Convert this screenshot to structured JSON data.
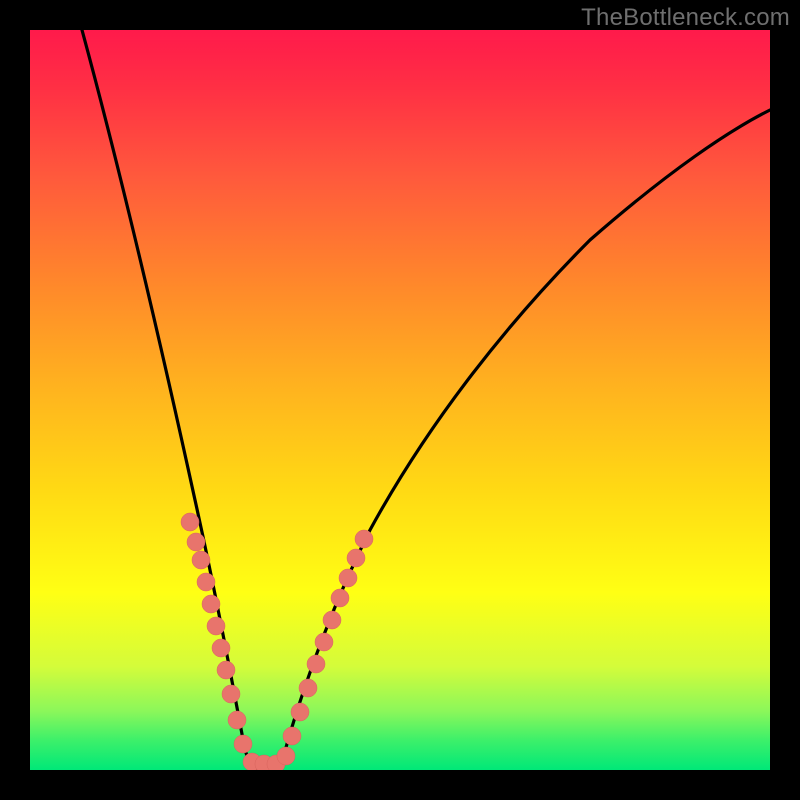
{
  "watermark": "TheBottleneck.com",
  "colors": {
    "frame": "#000000",
    "gradient_top": "#ff1a4b",
    "gradient_mid": "#ffd914",
    "gradient_bottom": "#00e878",
    "curve": "#000000",
    "dots": "#e8746c"
  },
  "chart_data": {
    "type": "line",
    "title": "",
    "xlabel": "",
    "ylabel": "",
    "xlim": [
      0,
      100
    ],
    "ylim": [
      0,
      100
    ],
    "grid": false,
    "legend": false,
    "note": "V-shaped curve; minimum at x≈30, y≈0. Dots cluster along the two arms in the lower ~35% of the chart.",
    "series": [
      {
        "name": "curve",
        "x": [
          7,
          10,
          13,
          16,
          19,
          22,
          25,
          28,
          30,
          32,
          35,
          40,
          45,
          50,
          55,
          60,
          65,
          70,
          75,
          80,
          85,
          90,
          95,
          100
        ],
        "y": [
          100,
          88,
          76,
          64,
          53,
          42,
          31,
          16,
          0,
          10,
          22,
          36,
          46,
          54,
          61,
          67,
          72,
          76,
          80,
          83,
          86,
          89,
          92,
          94
        ]
      },
      {
        "name": "dots-left",
        "x": [
          19,
          20,
          21,
          22,
          23,
          24,
          25,
          26,
          27,
          28,
          29
        ],
        "y": [
          34,
          32,
          29,
          27,
          24,
          20,
          17,
          13,
          8,
          4,
          1
        ]
      },
      {
        "name": "dots-right",
        "x": [
          31,
          32,
          33,
          34,
          35,
          36,
          37,
          38,
          39,
          40
        ],
        "y": [
          3,
          7,
          12,
          16,
          20,
          23,
          26,
          29,
          32,
          34
        ]
      },
      {
        "name": "dots-bottom",
        "x": [
          29,
          30,
          31,
          32
        ],
        "y": [
          0,
          0,
          0,
          0
        ]
      }
    ]
  }
}
